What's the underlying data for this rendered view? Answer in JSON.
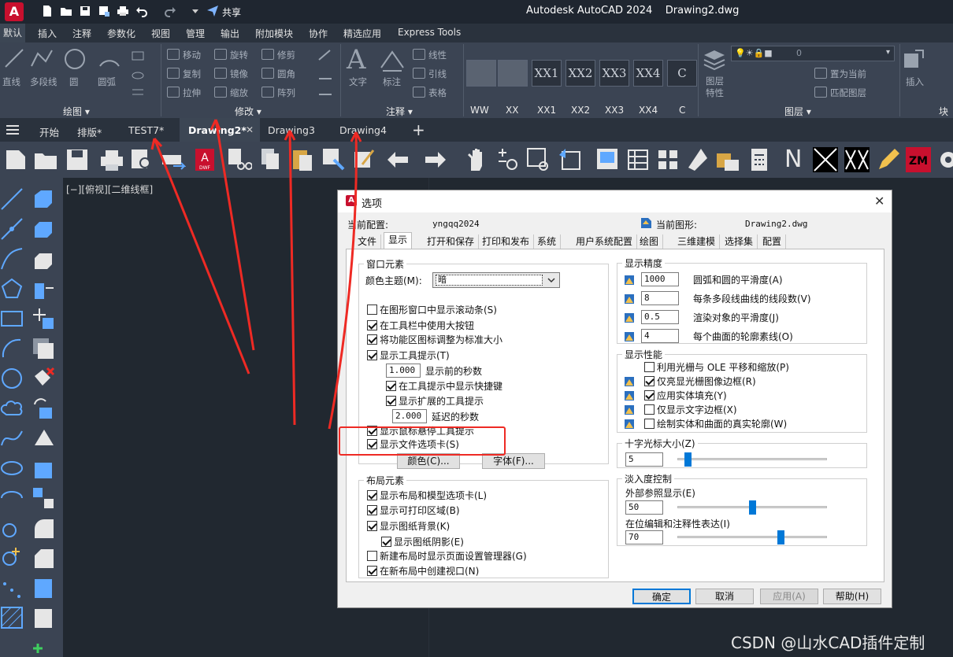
{
  "titlebar": {
    "app_logo": "A",
    "share_label": "共享",
    "title": "Autodesk AutoCAD 2024    Drawing2.dwg"
  },
  "ribbon_tabs": [
    "默认",
    "插入",
    "注释",
    "参数化",
    "视图",
    "管理",
    "输出",
    "附加模块",
    "协作",
    "精选应用",
    "Express Tools"
  ],
  "ribbon": {
    "draw_items": [
      "直线",
      "多段线",
      "圆",
      "圆弧"
    ],
    "modify_items": [
      "移动",
      "旋转",
      "修剪",
      "复制",
      "镜像",
      "圆角",
      "拉伸",
      "缩放",
      "阵列"
    ],
    "annotation_items": [
      "文字",
      "标注",
      "线性",
      "引线",
      "表格"
    ],
    "layer_items": [
      "图层特性",
      "置为当前",
      "匹配图层"
    ],
    "insert_label": "插入",
    "layer_combo_value": "0",
    "panel_labels": {
      "draw": "绘图 ▾",
      "modify": "修改 ▾",
      "annotation": "注释 ▾",
      "layer": "图层 ▾",
      "block": "块"
    },
    "xx_blocks": [
      "XX1",
      "XX2",
      "XX3",
      "XX4",
      "C"
    ],
    "xx_labels": [
      "WW",
      "XX",
      "XX1",
      "XX2",
      "XX3",
      "XX4",
      "C"
    ]
  },
  "filetabs": {
    "start": "开始",
    "tabs": [
      "排版*",
      "TEST7*",
      "Drawing2*",
      "Drawing3",
      "Drawing4"
    ],
    "close_glyph": "✕",
    "add_glyph": "+"
  },
  "viewport_label": "[−][俯视][二维线框]",
  "dialog": {
    "title": "选项",
    "current_profile_label": "当前配置:",
    "current_profile_value": "yngqq2024",
    "current_drawing_label": "当前图形:",
    "current_drawing_value": "Drawing2.dwg",
    "tabs": [
      "文件",
      "显示",
      "打开和保存",
      "打印和发布",
      "系统",
      "用户系统配置",
      "绘图",
      "三维建模",
      "选择集",
      "配置"
    ],
    "window_elements": {
      "title": "窗口元素",
      "color_theme_label": "颜色主题(M):",
      "color_theme_value": "暗",
      "checkboxes": [
        {
          "label": "在图形窗口中显示滚动条(S)",
          "checked": false
        },
        {
          "label": "在工具栏中使用大按钮",
          "checked": true
        },
        {
          "label": "将功能区图标调整为标准大小",
          "checked": true
        },
        {
          "label": "显示工具提示(T)",
          "checked": true
        }
      ],
      "tooltip_delay_value": "1.000",
      "tooltip_delay_label": "显示前的秒数",
      "show_shortcut_label": "在工具提示中显示快捷键",
      "show_extended_label": "显示扩展的工具提示",
      "extended_delay_value": "2.000",
      "extended_delay_label": "延迟的秒数",
      "rollover_label": "显示鼠标悬停工具提示",
      "file_tabs_label": "显示文件选项卡(S)",
      "colors_button": "颜色(C)...",
      "fonts_button": "字体(F)..."
    },
    "layout_elements": {
      "title": "布局元素",
      "checkboxes": [
        {
          "label": "显示布局和模型选项卡(L)",
          "checked": true
        },
        {
          "label": "显示可打印区域(B)",
          "checked": true
        },
        {
          "label": "显示图纸背景(K)",
          "checked": true
        },
        {
          "label": "显示图纸阴影(E)",
          "checked": true
        },
        {
          "label": "新建布局时显示页面设置管理器(G)",
          "checked": false
        },
        {
          "label": "在新布局中创建视口(N)",
          "checked": true
        }
      ]
    },
    "display_resolution": {
      "title": "显示精度",
      "rows": [
        {
          "value": "1000",
          "label": "圆弧和圆的平滑度(A)"
        },
        {
          "value": "8",
          "label": "每条多段线曲线的线段数(V)"
        },
        {
          "value": "0.5",
          "label": "渲染对象的平滑度(J)"
        },
        {
          "value": "4",
          "label": "每个曲面的轮廓素线(O)"
        }
      ]
    },
    "display_performance": {
      "title": "显示性能",
      "checkboxes": [
        {
          "label": "利用光栅与 OLE 平移和缩放(P)",
          "checked": false
        },
        {
          "label": "仅亮显光栅图像边框(R)",
          "checked": true
        },
        {
          "label": "应用实体填充(Y)",
          "checked": true
        },
        {
          "label": "仅显示文字边框(X)",
          "checked": false
        },
        {
          "label": "绘制实体和曲面的真实轮廓(W)",
          "checked": false
        }
      ]
    },
    "crosshair": {
      "title": "十字光标大小(Z)",
      "value": "5",
      "fraction": 0.05
    },
    "fade_control": {
      "title": "淡入度控制",
      "xref_label": "外部参照显示(E)",
      "xref_value": "50",
      "xref_fraction": 0.5,
      "inplace_label": "在位编辑和注释性表达(I)",
      "inplace_value": "70",
      "inplace_fraction": 0.7
    },
    "buttons": {
      "ok": "确定",
      "cancel": "取消",
      "apply": "应用(A)",
      "help": "帮助(H)"
    },
    "close_glyph": "✕"
  },
  "watermark": "CSDN @山水CAD插件定制",
  "colors": {
    "accent_red": "#ee2a24",
    "app_red": "#c8102e",
    "slider_blue": "#0078d7"
  }
}
